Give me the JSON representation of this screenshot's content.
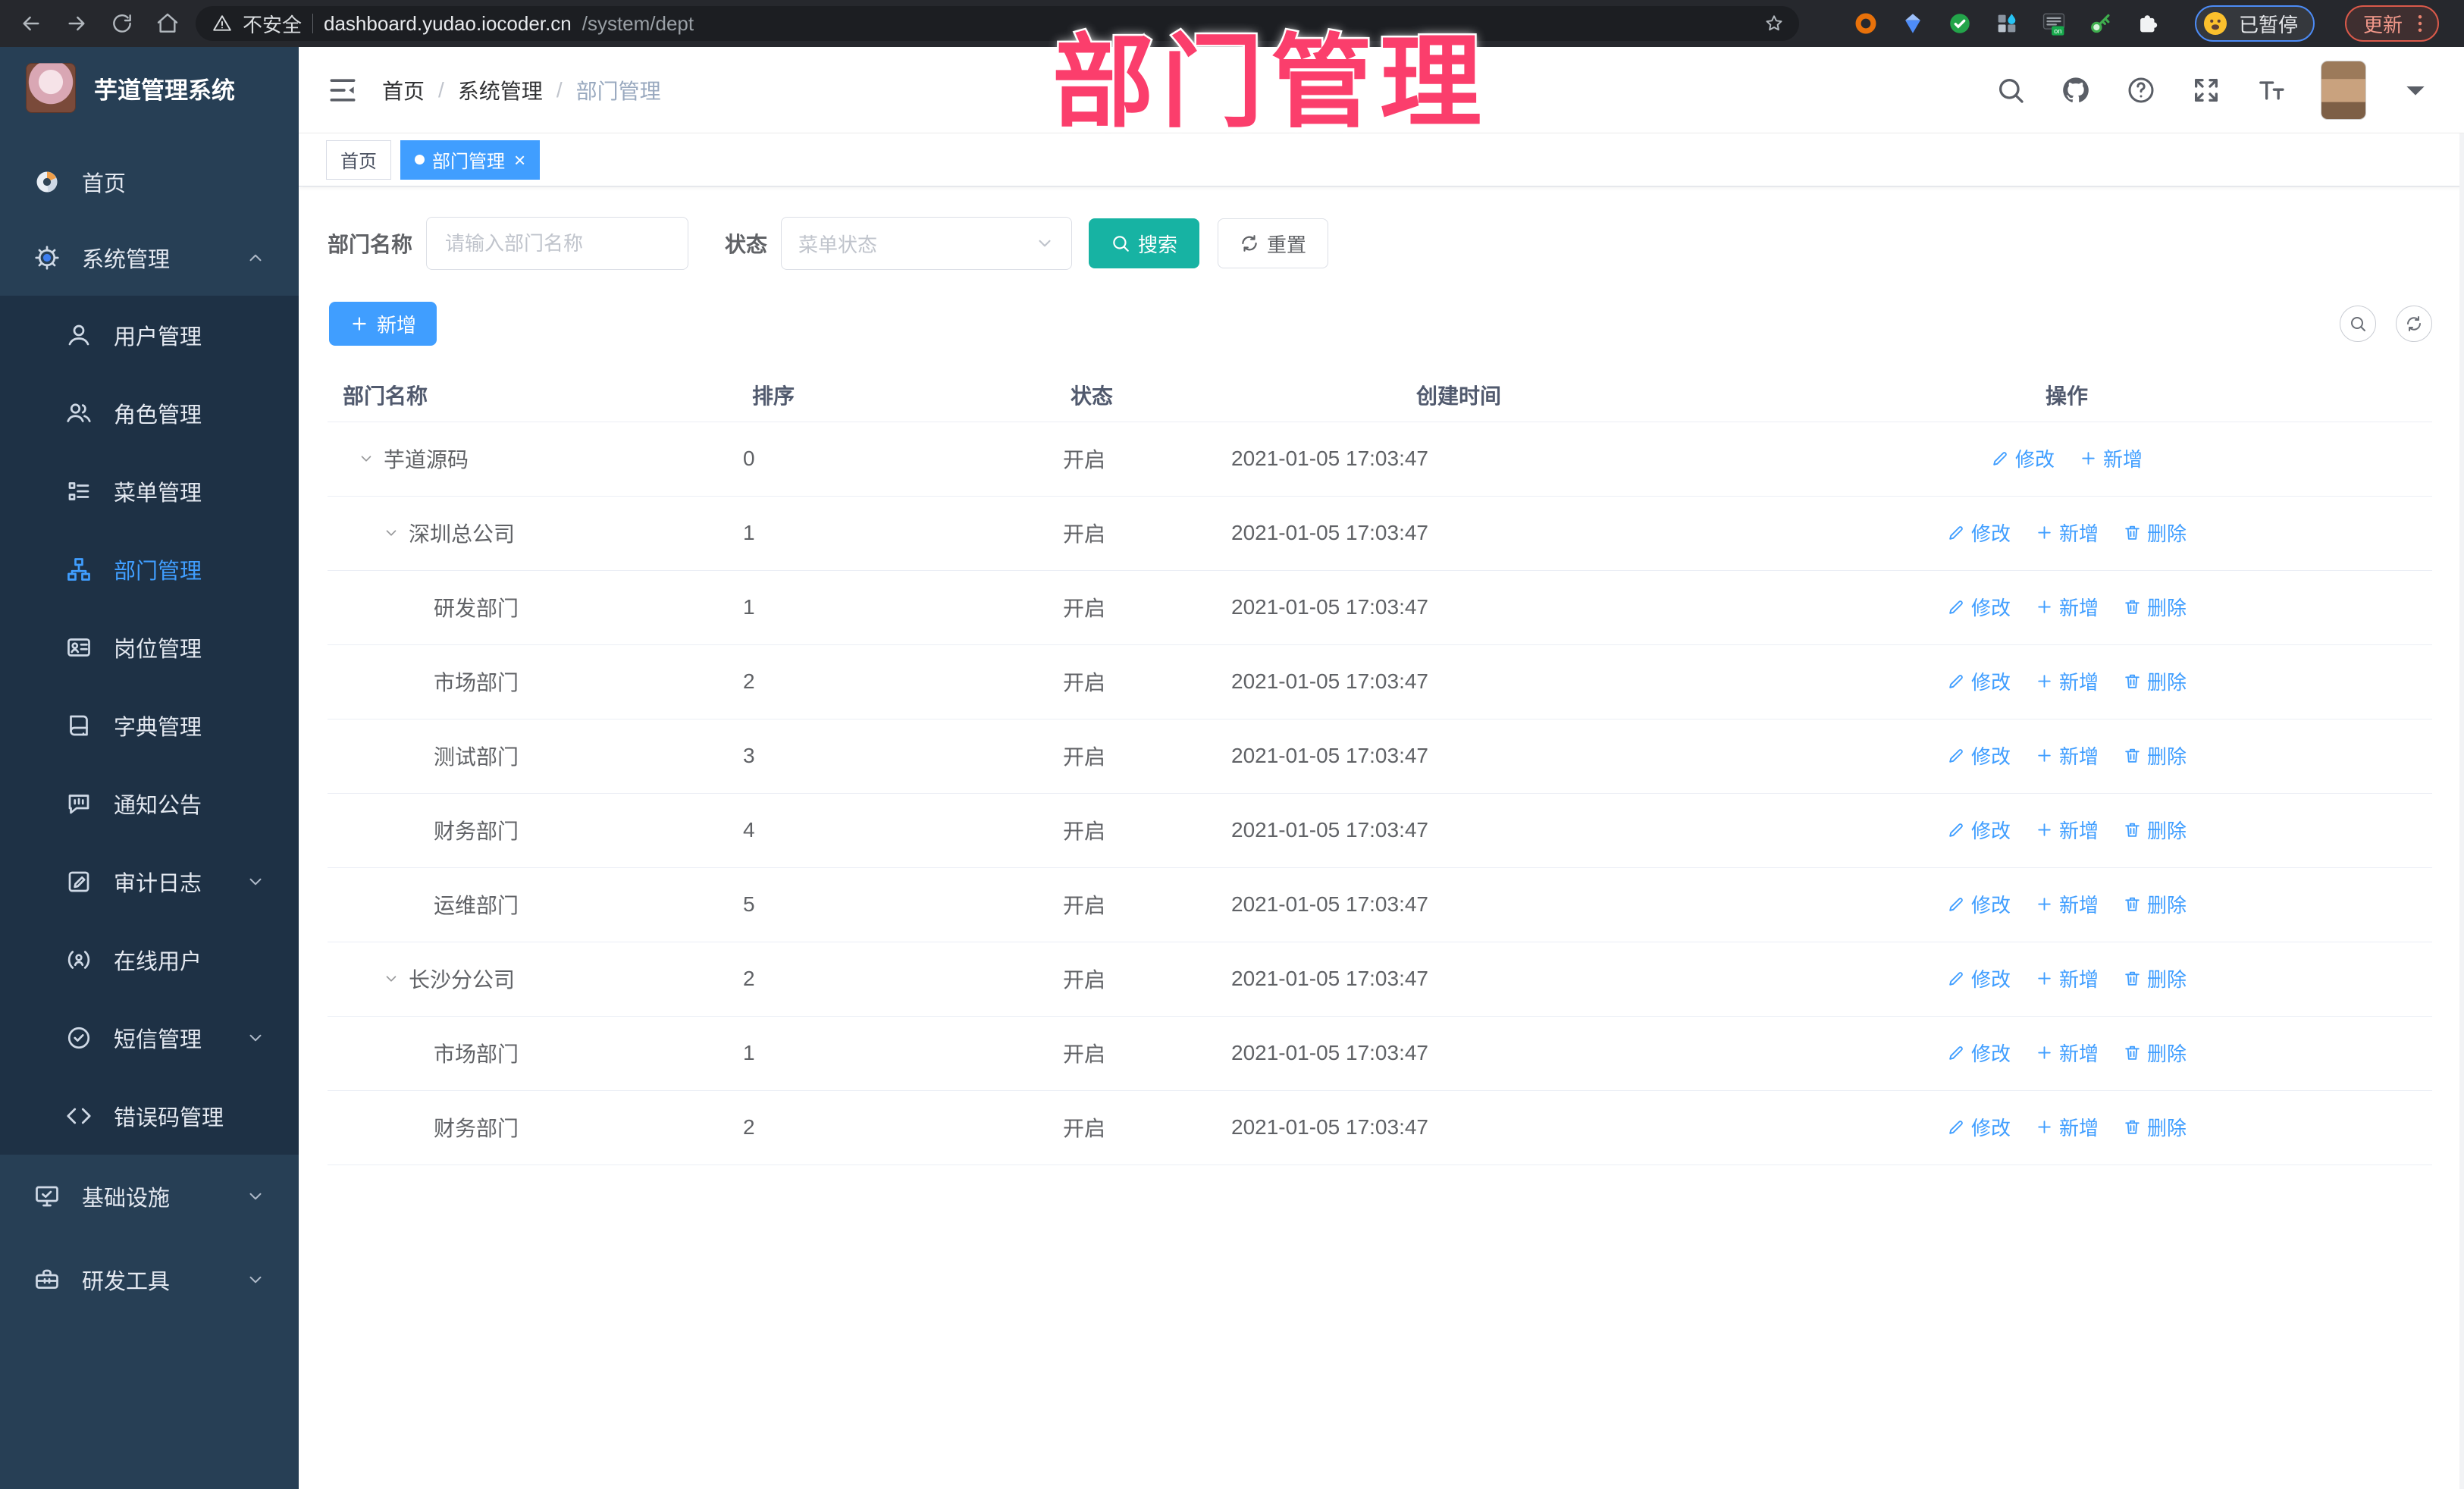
{
  "browser": {
    "security_label": "不安全",
    "url_host": "dashboard.yudao.iocoder.cn",
    "url_path": "/system/dept",
    "profile_status": "已暂停",
    "update_label": "更新"
  },
  "watermark": "部门管理",
  "sidebar": {
    "title": "芋道管理系统",
    "items": [
      {
        "label": "首页",
        "icon": "dashboard-icon",
        "type": "top"
      },
      {
        "label": "系统管理",
        "icon": "gear-icon",
        "type": "top",
        "chevron": "up",
        "expanded": true
      },
      {
        "label": "用户管理",
        "icon": "user-icon",
        "type": "sub"
      },
      {
        "label": "角色管理",
        "icon": "users-icon",
        "type": "sub"
      },
      {
        "label": "菜单管理",
        "icon": "menu-tree-icon",
        "type": "sub"
      },
      {
        "label": "部门管理",
        "icon": "org-tree-icon",
        "type": "sub",
        "active": true
      },
      {
        "label": "岗位管理",
        "icon": "id-card-icon",
        "type": "sub"
      },
      {
        "label": "字典管理",
        "icon": "dict-book-icon",
        "type": "sub"
      },
      {
        "label": "通知公告",
        "icon": "announcement-icon",
        "type": "sub"
      },
      {
        "label": "审计日志",
        "icon": "audit-log-icon",
        "type": "sub",
        "chevron": "down"
      },
      {
        "label": "在线用户",
        "icon": "online-user-icon",
        "type": "sub"
      },
      {
        "label": "短信管理",
        "icon": "sms-icon",
        "type": "sub",
        "chevron": "down"
      },
      {
        "label": "错误码管理",
        "icon": "error-code-icon",
        "type": "sub"
      },
      {
        "label": "基础设施",
        "icon": "infrastructure-icon",
        "type": "top",
        "chevron": "down",
        "section": "bottom"
      },
      {
        "label": "研发工具",
        "icon": "dev-tools-icon",
        "type": "top",
        "chevron": "down",
        "section": "bottom"
      }
    ]
  },
  "header": {
    "breadcrumb": [
      "首页",
      "系统管理",
      "部门管理"
    ]
  },
  "tabs": [
    {
      "label": "首页",
      "active": false,
      "closable": false
    },
    {
      "label": "部门管理",
      "active": true,
      "closable": true
    }
  ],
  "filter": {
    "dept_label": "部门名称",
    "dept_placeholder": "请输入部门名称",
    "status_label": "状态",
    "status_placeholder": "菜单状态",
    "search_label": "搜索",
    "reset_label": "重置"
  },
  "toolbar": {
    "add_label": "新增"
  },
  "table": {
    "columns": [
      "部门名称",
      "排序",
      "状态",
      "创建时间",
      "操作"
    ],
    "action_labels": {
      "modify": "修改",
      "add": "新增",
      "delete": "删除"
    },
    "rows": [
      {
        "name": "芋道源码",
        "sort": "0",
        "status": "开启",
        "created": "2021-01-05 17:03:47",
        "level": 0,
        "expandable": true,
        "actions": [
          "modify",
          "add"
        ]
      },
      {
        "name": "深圳总公司",
        "sort": "1",
        "status": "开启",
        "created": "2021-01-05 17:03:47",
        "level": 1,
        "expandable": true,
        "actions": [
          "modify",
          "add",
          "delete"
        ]
      },
      {
        "name": "研发部门",
        "sort": "1",
        "status": "开启",
        "created": "2021-01-05 17:03:47",
        "level": 2,
        "expandable": false,
        "actions": [
          "modify",
          "add",
          "delete"
        ]
      },
      {
        "name": "市场部门",
        "sort": "2",
        "status": "开启",
        "created": "2021-01-05 17:03:47",
        "level": 2,
        "expandable": false,
        "actions": [
          "modify",
          "add",
          "delete"
        ]
      },
      {
        "name": "测试部门",
        "sort": "3",
        "status": "开启",
        "created": "2021-01-05 17:03:47",
        "level": 2,
        "expandable": false,
        "actions": [
          "modify",
          "add",
          "delete"
        ]
      },
      {
        "name": "财务部门",
        "sort": "4",
        "status": "开启",
        "created": "2021-01-05 17:03:47",
        "level": 2,
        "expandable": false,
        "actions": [
          "modify",
          "add",
          "delete"
        ]
      },
      {
        "name": "运维部门",
        "sort": "5",
        "status": "开启",
        "created": "2021-01-05 17:03:47",
        "level": 2,
        "expandable": false,
        "actions": [
          "modify",
          "add",
          "delete"
        ]
      },
      {
        "name": "长沙分公司",
        "sort": "2",
        "status": "开启",
        "created": "2021-01-05 17:03:47",
        "level": 1,
        "expandable": true,
        "actions": [
          "modify",
          "add",
          "delete"
        ]
      },
      {
        "name": "市场部门",
        "sort": "1",
        "status": "开启",
        "created": "2021-01-05 17:03:47",
        "level": 2,
        "expandable": false,
        "actions": [
          "modify",
          "add",
          "delete"
        ]
      },
      {
        "name": "财务部门",
        "sort": "2",
        "status": "开启",
        "created": "2021-01-05 17:03:47",
        "level": 2,
        "expandable": false,
        "actions": [
          "modify",
          "add",
          "delete"
        ]
      }
    ]
  },
  "colors": {
    "accent": "#409EFF",
    "search_button": "#17B3A3",
    "watermark_pink": "#FB3E6C",
    "sidebar_bg": "#273F55",
    "submenu_bg": "#1E3145",
    "browser_bar": "#26282D"
  }
}
